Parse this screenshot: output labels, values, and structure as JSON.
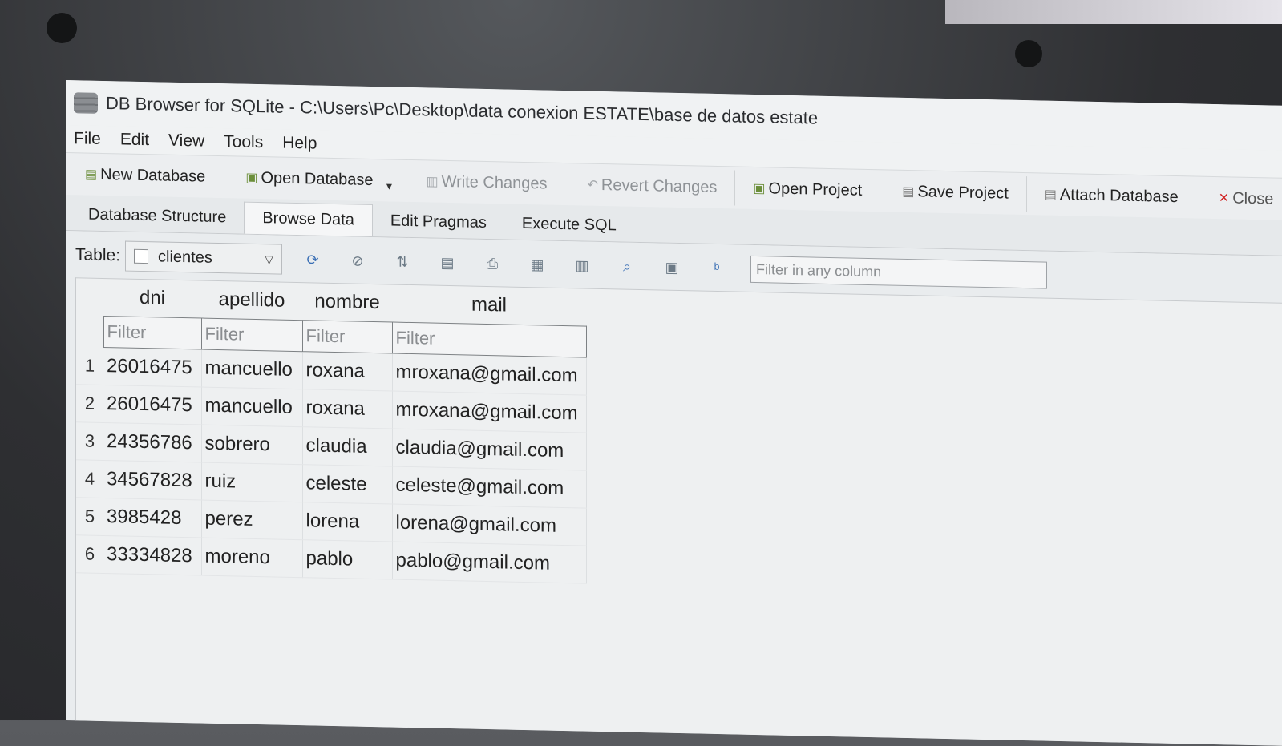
{
  "window": {
    "title": "DB Browser for SQLite - C:\\Users\\Pc\\Desktop\\data conexion ESTATE\\base de datos estate"
  },
  "menu": [
    "File",
    "Edit",
    "View",
    "Tools",
    "Help"
  ],
  "toolbar": {
    "new_database": "New Database",
    "open_database": "Open Database",
    "write_changes": "Write Changes",
    "revert_changes": "Revert Changes",
    "open_project": "Open Project",
    "save_project": "Save Project",
    "attach_database": "Attach Database",
    "close": "Close"
  },
  "tabs": [
    "Database Structure",
    "Browse Data",
    "Edit Pragmas",
    "Execute SQL"
  ],
  "active_tab": "Browse Data",
  "browse": {
    "table_label": "Table:",
    "selected_table": "clientes",
    "filter_any_placeholder": "Filter in any column",
    "filter_placeholder": "Filter",
    "columns": [
      "dni",
      "apellido",
      "nombre",
      "mail"
    ],
    "rows": [
      {
        "num": "1",
        "dni": "26016475",
        "apellido": "mancuello",
        "nombre": "roxana",
        "mail": "mroxana@gmail.com"
      },
      {
        "num": "2",
        "dni": "26016475",
        "apellido": "mancuello",
        "nombre": "roxana",
        "mail": "mroxana@gmail.com"
      },
      {
        "num": "3",
        "dni": "24356786",
        "apellido": "sobrero",
        "nombre": "claudia",
        "mail": "claudia@gmail.com"
      },
      {
        "num": "4",
        "dni": "34567828",
        "apellido": "ruiz",
        "nombre": "celeste",
        "mail": "celeste@gmail.com"
      },
      {
        "num": "5",
        "dni": "3985428",
        "apellido": "perez",
        "nombre": "lorena",
        "mail": "lorena@gmail.com"
      },
      {
        "num": "6",
        "dni": "33334828",
        "apellido": "moreno",
        "nombre": "pablo",
        "mail": "pablo@gmail.com"
      }
    ]
  },
  "colors": {
    "close_icon": "#d02020",
    "refresh_icon": "#3a6fb5"
  }
}
